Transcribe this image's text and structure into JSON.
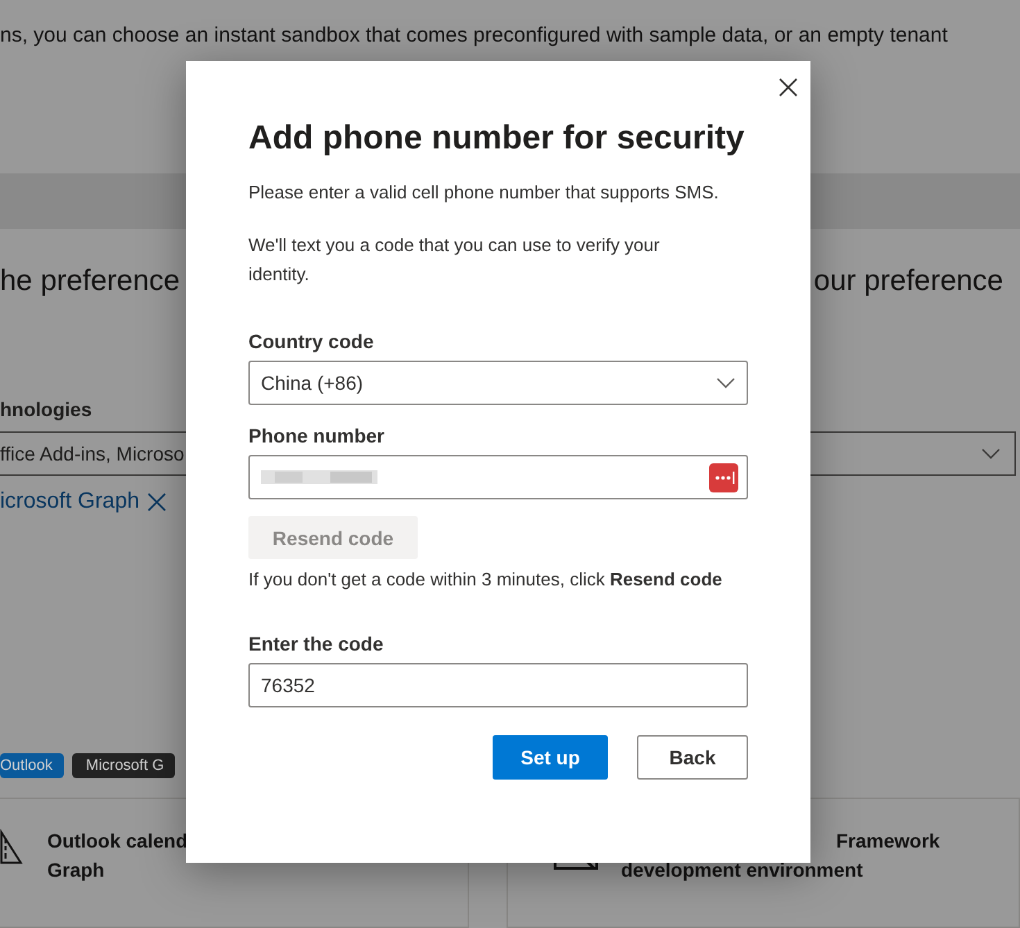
{
  "background_page": {
    "intro_text": "ns, you can choose an instant sandbox that comes preconfigured with sample data, or an empty tenant",
    "left_heading": "he preference",
    "right_heading": "our preference",
    "technologies_label": "hnologies",
    "technologies_dropdown": {
      "value": "ffice Add-ins, Microso"
    },
    "selected_chips": [
      {
        "label": "icrosoft Graph"
      }
    ],
    "tags": [
      {
        "label": "Outlook",
        "color": "#0a5a9c"
      },
      {
        "label": "Microsoft G",
        "color": "#232323"
      }
    ],
    "cards": [
      {
        "title_lines": [
          "Outlook calend",
          "Graph"
        ]
      },
      {
        "title_lines": [
          "Framework",
          "development environment"
        ]
      }
    ]
  },
  "dialog": {
    "title": "Add phone number for security",
    "instructions": [
      "Please enter a valid cell phone number that supports SMS.",
      "We'll text you a code that you can use to verify your identity."
    ],
    "country_code": {
      "label": "Country code",
      "value": "China (+86)"
    },
    "phone_number": {
      "label": "Phone number"
    },
    "resend_button": {
      "label": "Resend code",
      "disabled": true
    },
    "hint": "If you don't get a code within 3 minutes, click **Resend code**",
    "code": {
      "label": "Enter the code",
      "value": "76352"
    },
    "buttons": [
      {
        "label": "Set up",
        "kind": "primary"
      },
      {
        "label": "Back",
        "kind": "secondary"
      }
    ]
  }
}
